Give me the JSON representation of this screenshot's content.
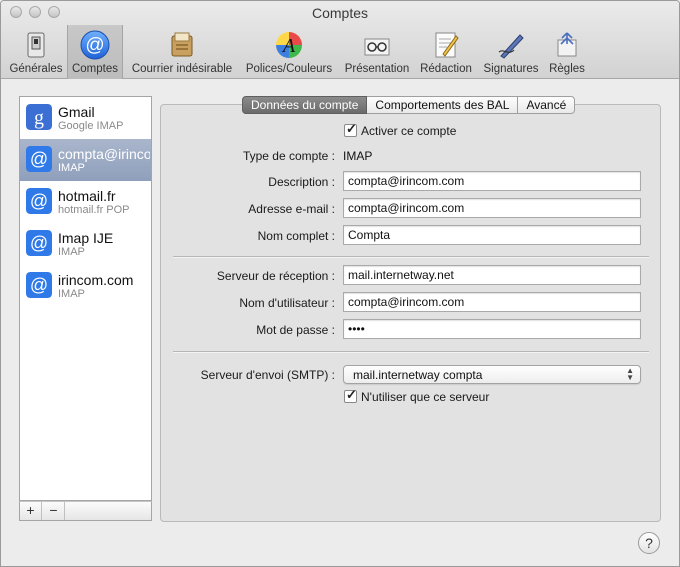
{
  "window": {
    "title": "Comptes"
  },
  "toolbar": {
    "items": [
      {
        "label": "Générales",
        "icon": "switch-icon"
      },
      {
        "label": "Comptes",
        "icon": "at-sign-icon",
        "selected": true
      },
      {
        "label": "Courrier indésirable",
        "icon": "junk-mail-icon"
      },
      {
        "label": "Polices/Couleurs",
        "icon": "fonts-colors-icon"
      },
      {
        "label": "Présentation",
        "icon": "viewing-glasses-icon"
      },
      {
        "label": "Rédaction",
        "icon": "composing-icon"
      },
      {
        "label": "Signatures",
        "icon": "signature-pen-icon"
      },
      {
        "label": "Règles",
        "icon": "rules-icon"
      }
    ]
  },
  "accounts": [
    {
      "name": "Gmail",
      "type": "Google IMAP",
      "icon": "google-icon"
    },
    {
      "name": "compta@irincom.com",
      "type": "IMAP",
      "icon": "at-sign-icon",
      "selected": true
    },
    {
      "name": "hotmail.fr",
      "type": "hotmail.fr POP",
      "icon": "at-sign-icon"
    },
    {
      "name": "Imap IJE",
      "type": "IMAP",
      "icon": "at-sign-icon"
    },
    {
      "name": "irincom.com",
      "type": "IMAP",
      "icon": "at-sign-icon"
    }
  ],
  "list_buttons": {
    "add": "+",
    "remove": "−"
  },
  "tabs": [
    "Données du compte",
    "Comportements des BAL",
    "Avancé"
  ],
  "form": {
    "activate_label": "Activer ce compte",
    "activate_checked": true,
    "account_type_label": "Type de compte :",
    "account_type_value": "IMAP",
    "description_label": "Description :",
    "description_value": "compta@irincom.com",
    "email_label": "Adresse e-mail :",
    "email_value": "compta@irincom.com",
    "fullname_label": "Nom complet :",
    "fullname_value": "Compta",
    "incoming_label": "Serveur de réception :",
    "incoming_value": "mail.internetway.net",
    "username_label": "Nom d'utilisateur :",
    "username_value": "compta@irincom.com",
    "password_label": "Mot de passe :",
    "password_value": "••••",
    "smtp_label": "Serveur d'envoi (SMTP) :",
    "smtp_value": "mail.internetway compta",
    "only_server_label": "N'utiliser que ce serveur",
    "only_server_checked": true
  },
  "help_label": "?",
  "colors": {
    "selection": "#97a6c0",
    "accent_blue": "#2f7ae8",
    "tab_active": "#777777"
  }
}
